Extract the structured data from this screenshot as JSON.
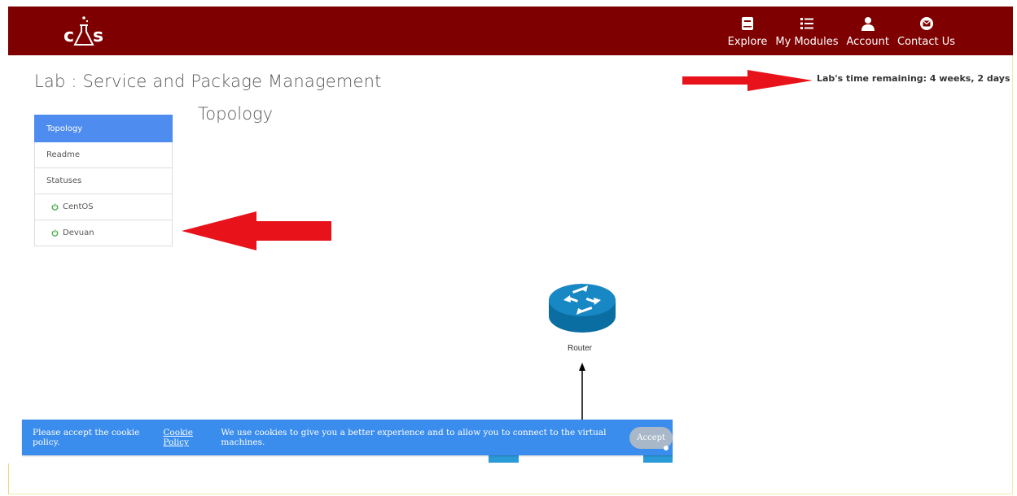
{
  "header": {
    "logo_alt": "CAS",
    "nav": [
      {
        "label": "Explore",
        "icon": "book-icon"
      },
      {
        "label": "My Modules",
        "icon": "list-icon"
      },
      {
        "label": "Account",
        "icon": "user-icon"
      },
      {
        "label": "Contact Us",
        "icon": "contact-icon"
      }
    ]
  },
  "page": {
    "title": "Lab : Service and Package Management",
    "time_remaining": "Lab's time remaining: 4 weeks, 2 days"
  },
  "sidebar": {
    "items": [
      {
        "label": "Topology",
        "active": true
      },
      {
        "label": "Readme"
      },
      {
        "label": "Statuses"
      },
      {
        "label": "CentOS",
        "status": "power-icon"
      },
      {
        "label": "Devuan",
        "status": "power-icon"
      }
    ]
  },
  "topology": {
    "title": "Topology",
    "router_label": "Router"
  },
  "cookie": {
    "text1": "Please accept the cookie policy.",
    "policy_link": "Cookie Policy",
    "text2": "We use cookies to give you a better experience and to allow you to connect to the virtual machines.",
    "accept_label": "Accept"
  },
  "colors": {
    "header_bg": "#7f0000",
    "active_tab": "#4e8cf0",
    "cookie_bg": "#3b8ded",
    "status_on": "#4caf50",
    "annotation_arrow": "#e8121b"
  }
}
